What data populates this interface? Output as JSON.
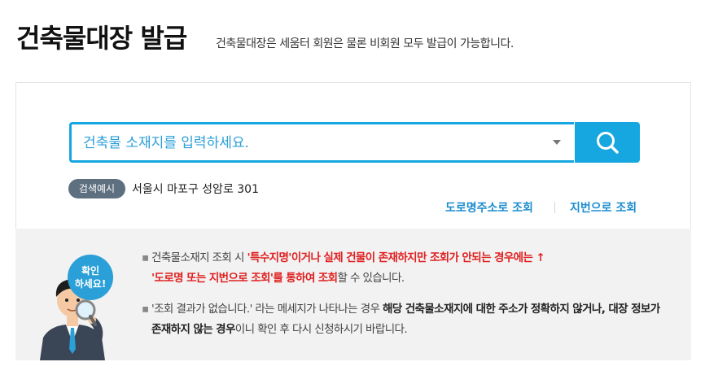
{
  "header": {
    "title": "건축물대장 발급",
    "subtitle": "건축물대장은 세움터 회원은 물론 비회원 모두 발급이 가능합니다."
  },
  "search": {
    "placeholder": "건축물 소재지를 입력하세요.",
    "value": "",
    "button_icon": "search-icon",
    "example_badge": "검색예시",
    "example_text": "서울시 마포구 성암로 301",
    "link_road": "도로명주소로 조회",
    "link_lot": "지번으로 조회"
  },
  "notice": {
    "mascot_bubble_line1": "확인",
    "mascot_bubble_line2": "하세요!",
    "bullet": "▪",
    "item1": {
      "prefix": "건축물소재지 조회 시 ",
      "highlight1": "'특수지명'이거나 실제 건물이 존재하지만 조회가 안되는 경우에는 ↑",
      "highlight2": "'도로명 또는 지번으로 조회'를 통하여 조회",
      "suffix": "할 수 있습니다."
    },
    "item2": {
      "prefix": "'조회 결과가 없습니다.' 라는 메세지가 나타나는 경우 ",
      "highlight": "해당 건축물소재지에 대한 주소가 정확하지 않거나, 대장 정보가 존재하지 않는 경우",
      "suffix": "이니 확인 후 다시 신청하시기 바랍니다."
    }
  },
  "colors": {
    "accent": "#16a6e0",
    "link": "#1b8ccf",
    "warning": "#e02020",
    "badge": "#5e6f80",
    "notice_bg": "#f2f2f2"
  }
}
